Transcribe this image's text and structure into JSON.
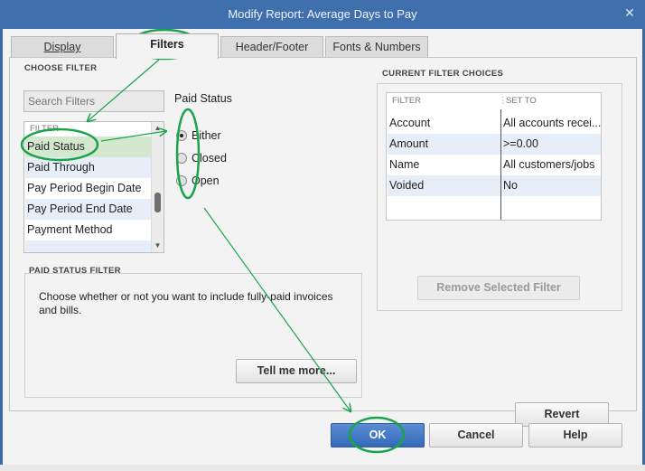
{
  "window": {
    "title": "Modify Report: Average Days to Pay",
    "close_glyph": "✕"
  },
  "tabs": [
    {
      "label": "Display"
    },
    {
      "label": "Filters"
    },
    {
      "label": "Header/Footer"
    },
    {
      "label": "Fonts & Numbers"
    }
  ],
  "choose_filter": {
    "label": "CHOOSE FILTER",
    "search_placeholder": "Search Filters",
    "list_header": "FILTER",
    "items": [
      "Paid Status",
      "Paid Through",
      "Pay Period Begin Date",
      "Pay Period End Date",
      "Payment Method"
    ]
  },
  "paid_status": {
    "title": "Paid Status",
    "options": [
      "Either",
      "Closed",
      "Open"
    ],
    "selected": "Either"
  },
  "paid_status_filter": {
    "label": "PAID STATUS FILTER",
    "description": "Choose whether or not you want to include fully-paid invoices and bills.",
    "tell_me_more": "Tell me more..."
  },
  "current_filters": {
    "label": "CURRENT FILTER CHOICES",
    "col_filter": "FILTER",
    "col_setto": "SET TO",
    "rows": [
      {
        "filter": "Account",
        "set_to": "All accounts recei..."
      },
      {
        "filter": "Amount",
        "set_to": ">=0.00"
      },
      {
        "filter": "Name",
        "set_to": "All customers/jobs"
      },
      {
        "filter": "Voided",
        "set_to": "No"
      }
    ],
    "remove_button": "Remove Selected Filter"
  },
  "buttons": {
    "revert": "Revert",
    "ok": "OK",
    "cancel": "Cancel",
    "help": "Help"
  },
  "colors": {
    "titlebar": "#3f70ad",
    "annotation": "#1aa34a",
    "ok_button": "#3a6fc0"
  },
  "icons": {
    "close": "close-icon",
    "scroll_up": "chevron-up-icon",
    "scroll_down": "chevron-down-icon"
  }
}
